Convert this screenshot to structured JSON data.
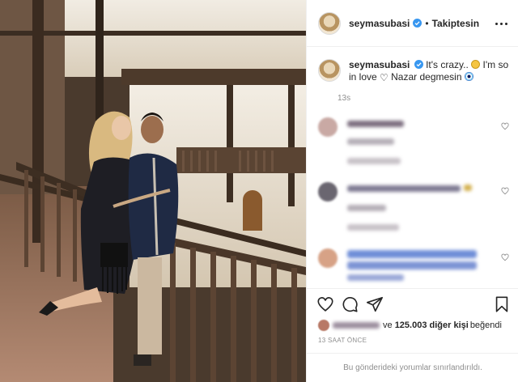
{
  "post": {
    "username": "seymasubasi",
    "follow_state": "Takiptesin",
    "separator": "•",
    "caption": {
      "username": "seymasubasi",
      "text_part1": "It's crazy..",
      "text_part2": "I'm so in love",
      "text_part3": "Nazar degmesin",
      "emojis": [
        "slightly-smiling-face",
        "white-heart",
        "nazar-amulet"
      ],
      "time": "13s"
    },
    "likes": {
      "connector": "ve",
      "count": "125.003",
      "suffix": "diğer kişi",
      "verb": "beğendi"
    },
    "time_ago": "13 SAAT ÖNCE",
    "comments_notice": "Bu gönderideki yorumlar sınırlandırıldı.",
    "icons": {
      "like": "heart-icon",
      "comment": "comment-icon",
      "share": "share-icon",
      "save": "bookmark-icon",
      "options": "more-options-icon",
      "verified": "verified-badge-icon"
    },
    "colors": {
      "verified": "#3897f0",
      "text": "#262626",
      "muted": "#8e8e8e",
      "border": "#efefef"
    }
  }
}
